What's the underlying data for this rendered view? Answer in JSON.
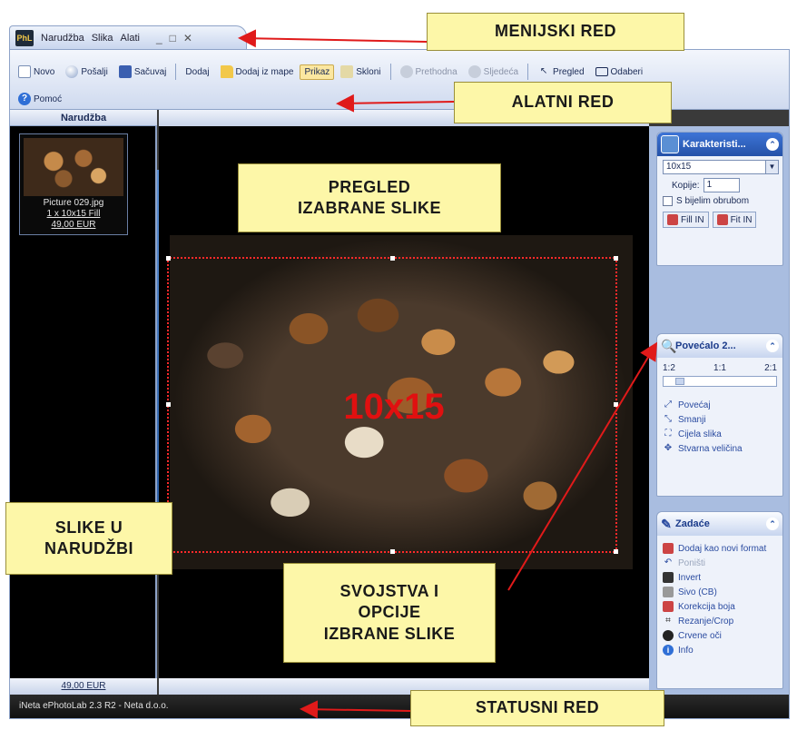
{
  "app": {
    "menu": [
      "Narudžba",
      "Slika",
      "Alati"
    ],
    "window_controls": [
      "_",
      "□",
      "✕"
    ]
  },
  "toolbar": {
    "row1": [
      {
        "label": "Novo",
        "icon": "new-document-icon"
      },
      {
        "label": "Pošalji",
        "icon": "send-icon"
      },
      {
        "label": "Sačuvaj",
        "icon": "save-icon"
      },
      {
        "label": "Dodaj",
        "icon": "add-photo-icon"
      },
      {
        "label": "Dodaj iz mape",
        "icon": "folder-icon"
      },
      {
        "label": "Prikaz",
        "icon": "view-icon"
      },
      {
        "label": "Skloni",
        "icon": "folder-remove-icon"
      },
      {
        "label": "Prethodna",
        "icon": "previous-icon"
      },
      {
        "label": "Sljedeća",
        "icon": "next-icon"
      },
      {
        "label": "Pregled",
        "icon": "cursor-icon"
      },
      {
        "label": "Odaberi",
        "icon": "select-frame-icon"
      }
    ],
    "row2": [
      {
        "label": "Pomoć",
        "icon": "help-icon"
      }
    ]
  },
  "left_panel": {
    "header": "Narudžba",
    "thumbnail": {
      "filename": "Picture 029.jpg",
      "spec": "1 x 10x15 Fill",
      "price": "49,00 EUR"
    },
    "total": "49,00 EUR"
  },
  "preview": {
    "size_overlay": "10x15"
  },
  "properties": {
    "title": "Karakteristi...",
    "format_selected": "10x15",
    "copies_label": "Kopije:",
    "copies_value": "1",
    "white_border_label": "S bijelim obrubom",
    "fill_in_label": "Fill IN",
    "fit_in_label": "Fit IN"
  },
  "zoom": {
    "title": "Povećalo 2...",
    "marks": [
      "1:2",
      "1:1",
      "2:1"
    ],
    "level": 0.12,
    "actions": [
      "Povećaj",
      "Smanji",
      "Cijela slika",
      "Stvarna veličina"
    ]
  },
  "tasks": {
    "title": "Zadaće",
    "items": [
      {
        "label": "Dodaj kao novi format",
        "icon": "add-format-icon",
        "disabled": false
      },
      {
        "label": "Poništi",
        "icon": "undo-icon",
        "disabled": true
      },
      {
        "label": "Invert",
        "icon": "invert-icon",
        "disabled": false
      },
      {
        "label": "Sivo (CB)",
        "icon": "grayscale-icon",
        "disabled": false
      },
      {
        "label": "Korekcija boja",
        "icon": "color-correction-icon",
        "disabled": false
      },
      {
        "label": "Rezanje/Crop",
        "icon": "crop-icon",
        "disabled": false
      },
      {
        "label": "Crvene oči",
        "icon": "red-eye-icon",
        "disabled": false
      },
      {
        "label": "Info",
        "icon": "info-icon",
        "disabled": false
      }
    ]
  },
  "status_bar": "iNeta ePhotoLab 2.3 R2 - Neta d.o.o.",
  "callouts": {
    "menu_row": "MENIJSKI RED",
    "tool_row": "ALATNI RED",
    "preview_line1": "PREGLED",
    "preview_line2": "IZABRANE SLIKE",
    "order_line1": "SLIKE U",
    "order_line2": "NARUDŽBI",
    "props_line1": "SVOJSTVA I",
    "props_line2": "OPCIJE",
    "props_line3": "IZBRANE SLIKE",
    "status_row": "STATUSNI RED"
  },
  "colors": {
    "callout_bg": "#fdf7a8",
    "arrow": "#e01a1a",
    "crop_frame": "#ff2a2a",
    "panel_blue": "#a9bde0"
  }
}
